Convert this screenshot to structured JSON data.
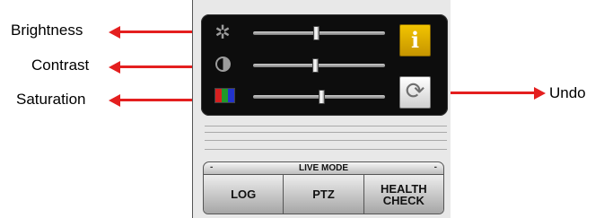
{
  "callouts": {
    "brightness": "Brightness",
    "contrast": "Contrast",
    "saturation": "Saturation",
    "undo": "Undo"
  },
  "sliders": {
    "brightness": {
      "value_percent": 48
    },
    "contrast": {
      "value_percent": 47
    },
    "saturation": {
      "value_percent": 52
    }
  },
  "buttons": {
    "info_label": "i",
    "undo_icon": "refresh-icon"
  },
  "mode_bar": {
    "left_mark": "-",
    "label": "LIVE MODE",
    "right_mark": "-"
  },
  "tabs": [
    {
      "label": "LOG"
    },
    {
      "label": "PTZ"
    },
    {
      "label": "HEALTH\nCHECK"
    }
  ],
  "colors": {
    "annotation_arrow": "#e41f1f",
    "info_button": "#e0b000",
    "panel_dark": "#0d0d0d",
    "saturation_icon": [
      "#d62020",
      "#1f9a2a",
      "#2233cc"
    ]
  }
}
